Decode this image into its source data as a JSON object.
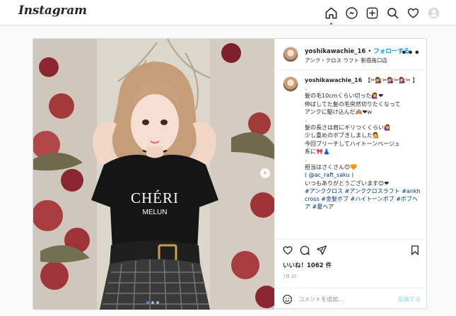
{
  "nav": {
    "logo": "Instagram",
    "icons": [
      "home-icon",
      "messenger-icon",
      "new-post-icon",
      "explore-icon",
      "activity-heart-icon",
      "profile-avatar"
    ]
  },
  "post": {
    "username": "yoshikawachie_16",
    "separator": "•",
    "follow_label": "フォローする",
    "location": "アンク・クロス ラフト 新宿南口店",
    "more_label": "•••",
    "image_text": {
      "shirt_line1": "CHÉRI",
      "shirt_line2": "MELUN"
    },
    "caption": {
      "username": "yoshikawachie_16",
      "lines": [
        "【✂💇‍♀️✂💇‍♀️✂💇‍♀️✂ 】",
        ".",
        "髪の毛10cmくらい切った🙋‍♀️❤",
        "伸ばしてた髪の毛突然切りたくなって",
        "アンクに駆け込んだ🙈❤w",
        ".",
        "髪の長さは肩にギリつくくらい🙋‍♀️",
        "少し重めのボブきしました💁",
        "今回ブリーチしてハイトーンベージュ",
        "系に🎀👗",
        ".",
        "担当はさくさん😊🧡",
        "( @ac_raft_saku )",
        "いつもありがとうございます😊❤"
      ],
      "hashtags": "#アンククロス #アンククロスラフト #ankhcross #金髪ボブ #ハイトーンボブ #ボブヘア #夏ヘア"
    },
    "likes": "いいね！1062 件",
    "date": "7月 25",
    "comment_placeholder": "コメントを追加...",
    "post_button": "投稿する"
  },
  "colors": {
    "link": "#0095f6",
    "hashtag": "#00376b",
    "notification_dot": "#ed4956",
    "post_button_disabled": "#b2dffc"
  }
}
